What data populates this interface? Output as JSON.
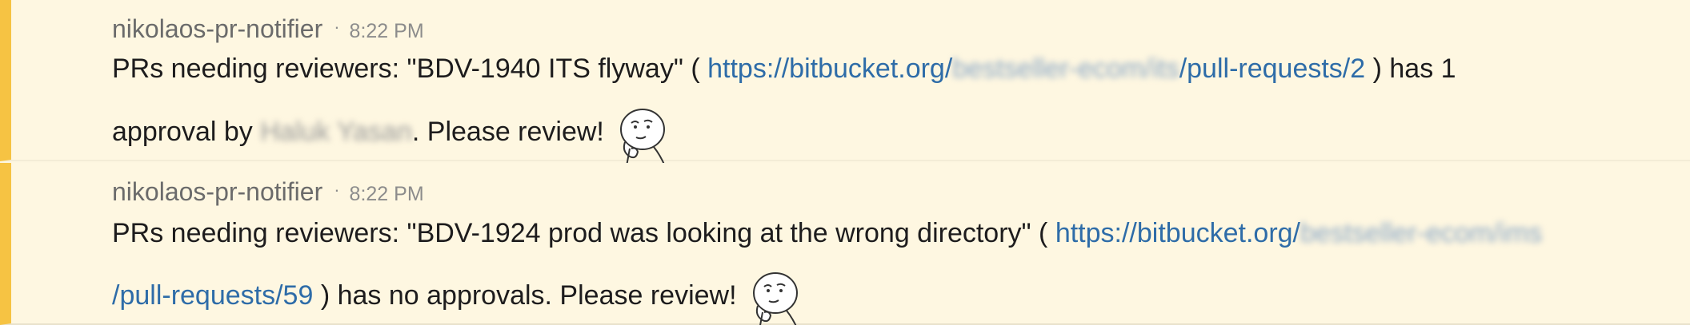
{
  "messages": [
    {
      "sender": "nikolaos-pr-notifier",
      "separator": "·",
      "time": "8:22 PM",
      "prefix": "PRs needing reviewers: \"BDV-1940 ITS flyway\" ( ",
      "link_start": "https://bitbucket.org/",
      "link_blurred": "bestseller-ecom/its",
      "link_end": "/pull-requests/2",
      "suffix": " ) has 1",
      "line2_prefix": "approval by ",
      "blurred_name": "Haluk Yasan",
      "line2_suffix": ". Please review!",
      "emoji": "thinking-face-emoji"
    },
    {
      "sender": "nikolaos-pr-notifier",
      "separator": "·",
      "time": "8:22 PM",
      "prefix": "PRs needing reviewers: \"BDV-1924 prod was looking at the wrong directory\" ( ",
      "link_start": "https://bitbucket.org/",
      "link_blurred": "bestseller-ecom/ims",
      "link_end": "/pull-requests/59",
      "line2_suffix": " ) has no approvals. Please review!",
      "emoji": "thinking-face-emoji"
    }
  ],
  "colors": {
    "background": "#fef7e1",
    "accent_bar": "#f6c343",
    "link": "#2e6ca8",
    "sender": "#6b6b6b",
    "time": "#8c8c8c",
    "text": "#1d1c1d"
  }
}
